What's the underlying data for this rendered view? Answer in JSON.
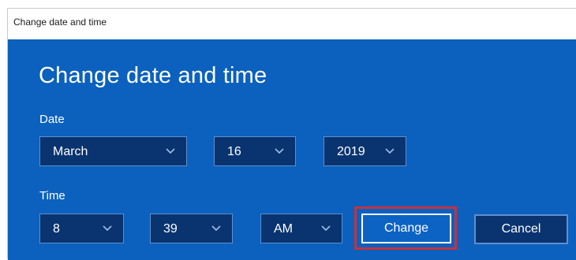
{
  "window": {
    "title": "Change date and time"
  },
  "heading": "Change date and time",
  "date": {
    "label": "Date",
    "month": "March",
    "day": "16",
    "year": "2019"
  },
  "time": {
    "label": "Time",
    "hour": "8",
    "minute": "39",
    "ampm": "AM"
  },
  "buttons": {
    "change": "Change",
    "cancel": "Cancel"
  },
  "colors": {
    "panel": "#0b61bd",
    "field": "#0a3470",
    "highlight": "#c4323f"
  },
  "icons": {
    "dropdown": "chevron-down-icon"
  }
}
